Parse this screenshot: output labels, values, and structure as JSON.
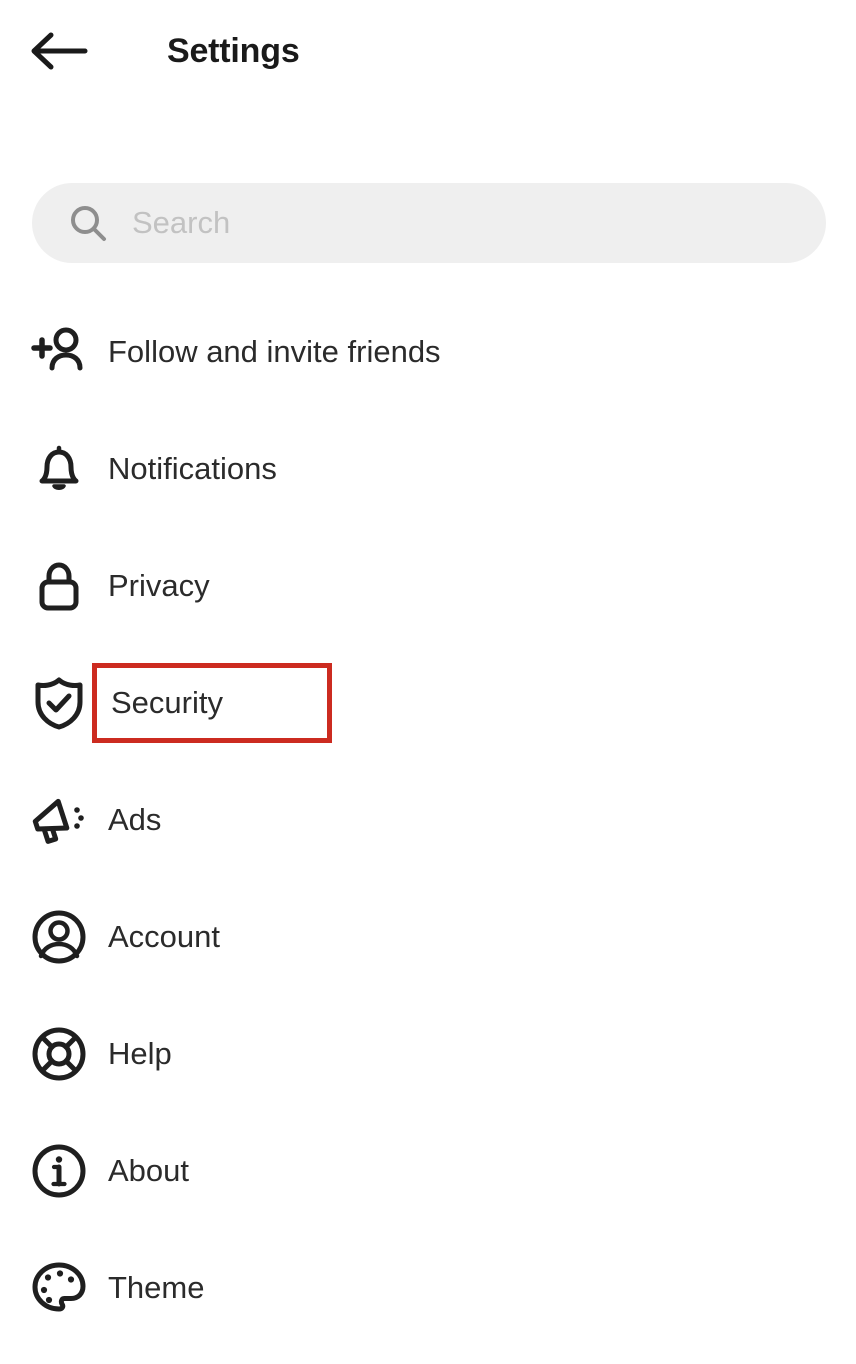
{
  "header": {
    "title": "Settings",
    "back_icon": "arrow-left-icon"
  },
  "search": {
    "placeholder": "Search",
    "value": "",
    "icon": "search-icon",
    "background": "#efefef"
  },
  "highlight": {
    "color": "#cc2b20",
    "target": "Security"
  },
  "menu": {
    "items": [
      {
        "label": "Follow and invite friends",
        "icon": "person-add-icon",
        "highlighted": false
      },
      {
        "label": "Notifications",
        "icon": "bell-icon",
        "highlighted": false
      },
      {
        "label": "Privacy",
        "icon": "lock-icon",
        "highlighted": false
      },
      {
        "label": "Security",
        "icon": "shield-check-icon",
        "highlighted": true
      },
      {
        "label": "Ads",
        "icon": "megaphone-icon",
        "highlighted": false
      },
      {
        "label": "Account",
        "icon": "account-circle-icon",
        "highlighted": false
      },
      {
        "label": "Help",
        "icon": "lifebuoy-icon",
        "highlighted": false
      },
      {
        "label": "About",
        "icon": "info-circle-icon",
        "highlighted": false
      },
      {
        "label": "Theme",
        "icon": "palette-icon",
        "highlighted": false
      }
    ]
  }
}
